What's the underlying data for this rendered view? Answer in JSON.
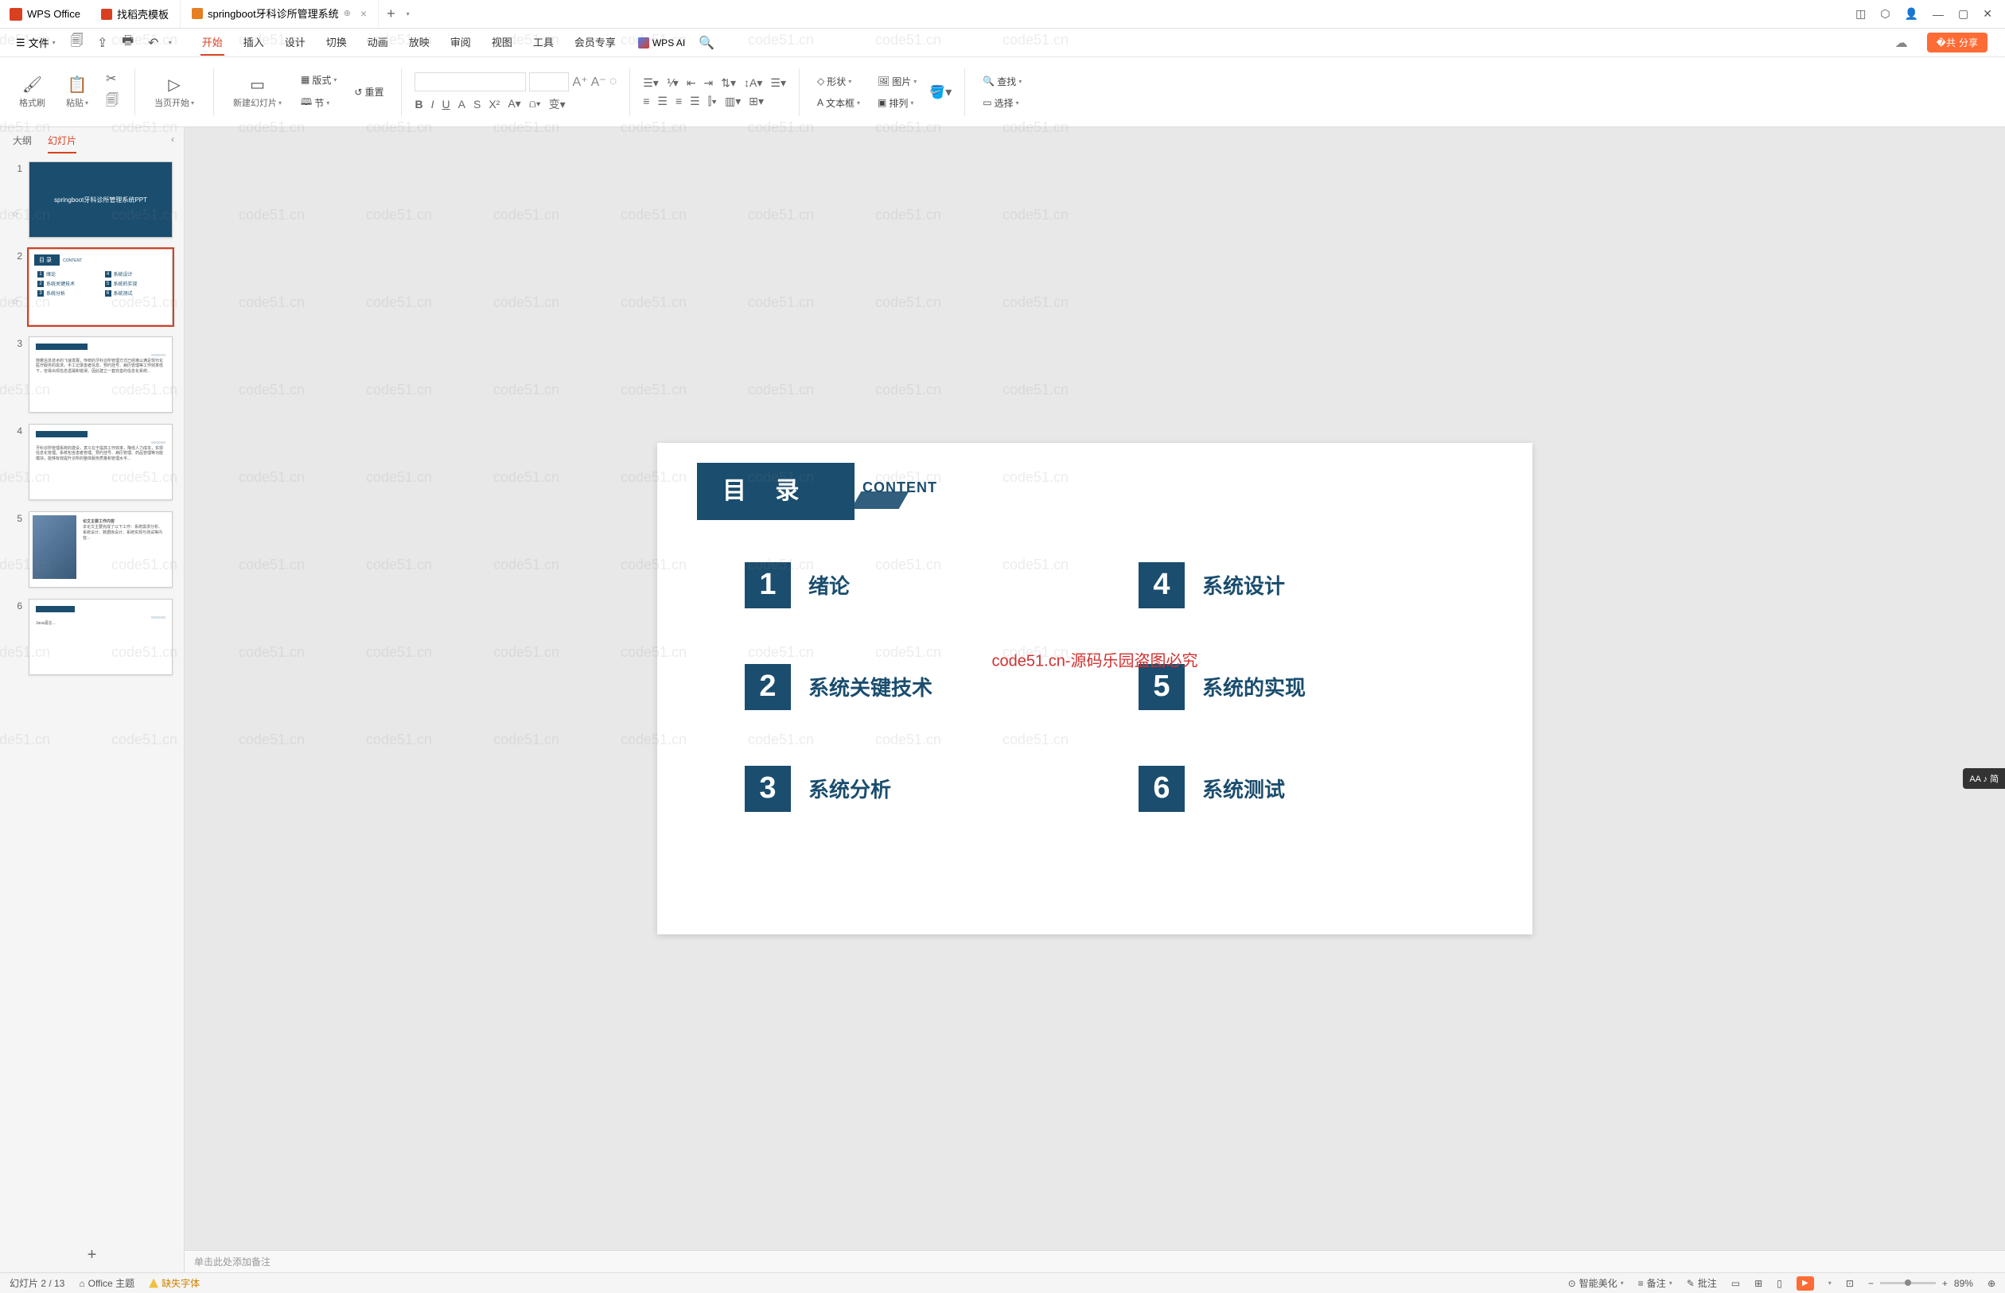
{
  "titlebar": {
    "app_name": "WPS Office",
    "tabs": [
      {
        "label": "找稻壳模板"
      },
      {
        "label": "springboot牙科诊所管理系统"
      }
    ],
    "add": "+"
  },
  "menubar": {
    "file": "文件",
    "items": [
      "开始",
      "插入",
      "设计",
      "切换",
      "动画",
      "放映",
      "审阅",
      "视图",
      "工具",
      "会员专享"
    ],
    "ai_label": "WPS AI",
    "share": "分享"
  },
  "ribbon": {
    "format_brush": "格式刷",
    "paste": "粘贴",
    "from_current": "当页开始",
    "new_slide": "新建幻灯片",
    "layout": "版式",
    "section": "节",
    "reset": "重置",
    "shape": "形状",
    "image": "图片",
    "textbox": "文本框",
    "arrange": "排列",
    "find": "查找",
    "select": "选择"
  },
  "slidepanel": {
    "tab_outline": "大纲",
    "tab_slides": "幻灯片",
    "thumb1_title": "springboot牙科诊所管理系统PPT",
    "th2": {
      "title": "目 录",
      "content": "CONTENT",
      "items": [
        "绪论",
        "系统设计",
        "系统关键技术",
        "系统的实现",
        "系统分析",
        "系统测试"
      ]
    },
    "th5_title": "论文主要工作内容",
    "add": "+"
  },
  "canvas": {
    "toc_title": "目 录",
    "toc_content": "CONTENT",
    "items": [
      {
        "num": "1",
        "text": "绪论"
      },
      {
        "num": "4",
        "text": "系统设计"
      },
      {
        "num": "2",
        "text": "系统关键技术"
      },
      {
        "num": "5",
        "text": "系统的实现"
      },
      {
        "num": "3",
        "text": "系统分析"
      },
      {
        "num": "6",
        "text": "系统测试"
      }
    ],
    "watermark_center": "code51.cn-源码乐园盗图必究",
    "notes_placeholder": "单击此处添加备注"
  },
  "float_badge": "AA ♪ 简",
  "statusbar": {
    "slide_count": "幻灯片 2 / 13",
    "theme": "Office 主题",
    "missing_font": "缺失字体",
    "beautify": "智能美化",
    "notes": "备注",
    "comments": "批注",
    "zoom_pct": "89%"
  },
  "watermark_text": "code51.cn"
}
